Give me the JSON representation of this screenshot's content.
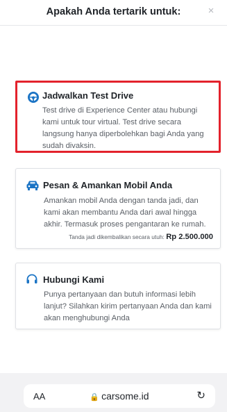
{
  "header": {
    "title": "Apakah Anda tertarik untuk:",
    "close_label": "×"
  },
  "options": [
    {
      "title": "Jadwalkan Test Drive",
      "icon": "steering-wheel-icon",
      "description": "Test drive di Experience Center atau hubungi kami untuk tour virtual. Test drive secara langsung hanya diperbolehkan bagi Anda yang sudah divaksin.",
      "highlighted": true
    },
    {
      "title": "Pesan & Amankan Mobil Anda",
      "icon": "car-icon",
      "description": "Amankan mobil Anda dengan tanda jadi, dan kami akan membantu Anda dari awal hingga akhir. Termasuk proses pengantaran ke rumah.",
      "deposit_note": "Tanda jadi dikembalikan secara utuh:",
      "deposit_amount": "Rp 2.500.000"
    },
    {
      "title": "Hubungi Kami",
      "icon": "headset-icon",
      "description": "Punya pertanyaan dan butuh informasi lebih lanjut? Silahkan kirim pertanyaan Anda dan kami akan menghubungi Anda"
    }
  ],
  "browser": {
    "text_size": "AA",
    "url": "carsome.id",
    "reload": "↻"
  },
  "colors": {
    "accent": "#1b74c5",
    "highlight_border": "#e3222c"
  }
}
